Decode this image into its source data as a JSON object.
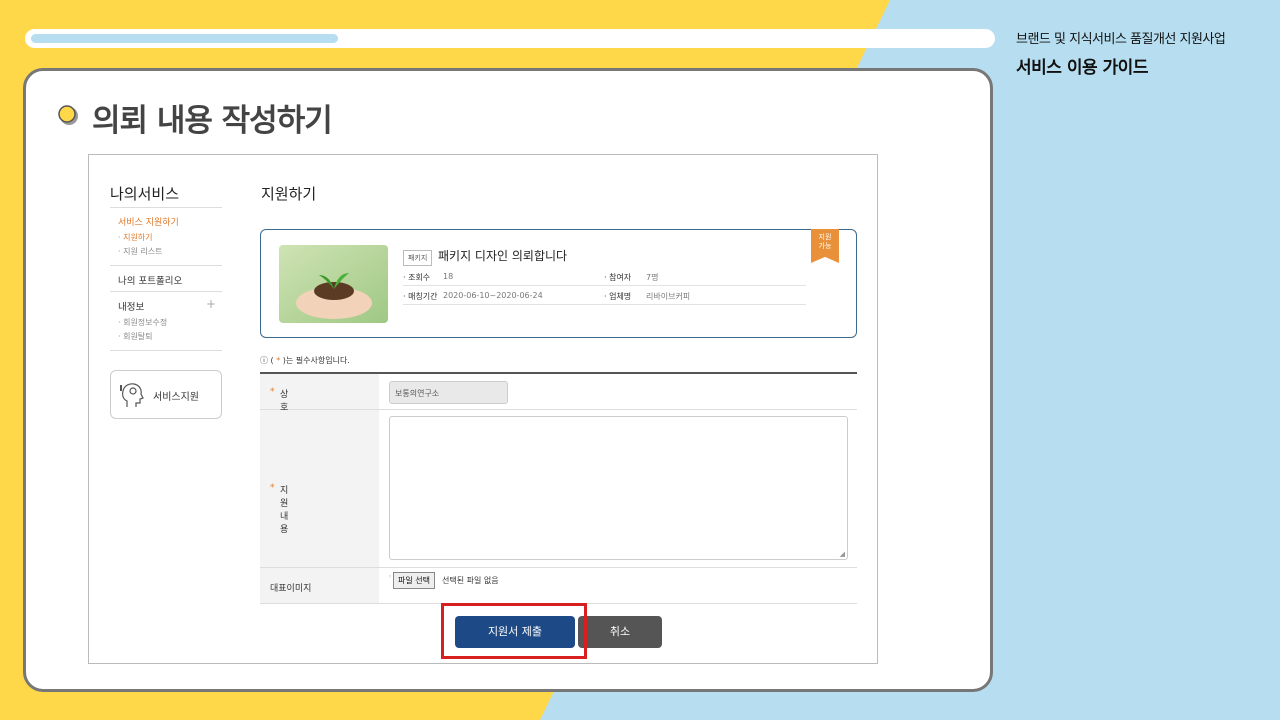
{
  "slide": {
    "progress": 0.32,
    "header_sub": "브랜드 및 지식서비스 품질개선 지원사업",
    "header_title": "서비스 이용 가이드",
    "card_title": "의뢰 내용 작성하기"
  },
  "sidebar": {
    "title": "나의서비스",
    "section": "서비스 지원하기",
    "sub_items": [
      "· 지원하기",
      "· 지원 리스트"
    ],
    "portfolio": "나의 포트폴리오",
    "myinfo": "내정보",
    "myinfo_items": [
      "· 회원정보수정",
      "· 회원탈퇴"
    ],
    "support_label": "서비스지원"
  },
  "main": {
    "title": "지원하기",
    "package": {
      "badge": "패키지",
      "title": "패키지 디자인 의뢰합니다",
      "ribbon": [
        "지원",
        "가능"
      ],
      "views_label": "· 조회수",
      "views": "18",
      "participants_label": "· 참여자",
      "participants": "7명",
      "period_label": "· 매칭기간",
      "period": "2020-06-10~2020-06-24",
      "company_label": "· 업체명",
      "company": "리바이브커피"
    },
    "required_note_pre": "( ",
    "required_note_star": "*",
    "required_note_post": " )는 필수사항입니다.",
    "form": {
      "company_label": "상호명",
      "company_value": "보통의연구소",
      "content_label": "지원내용",
      "image_label": "대표이미지",
      "file_button": "파일 선택",
      "file_status": "선택된 파일 없음",
      "required_star": "*"
    },
    "submit_label": "지원서 제출",
    "cancel_label": "취소"
  }
}
